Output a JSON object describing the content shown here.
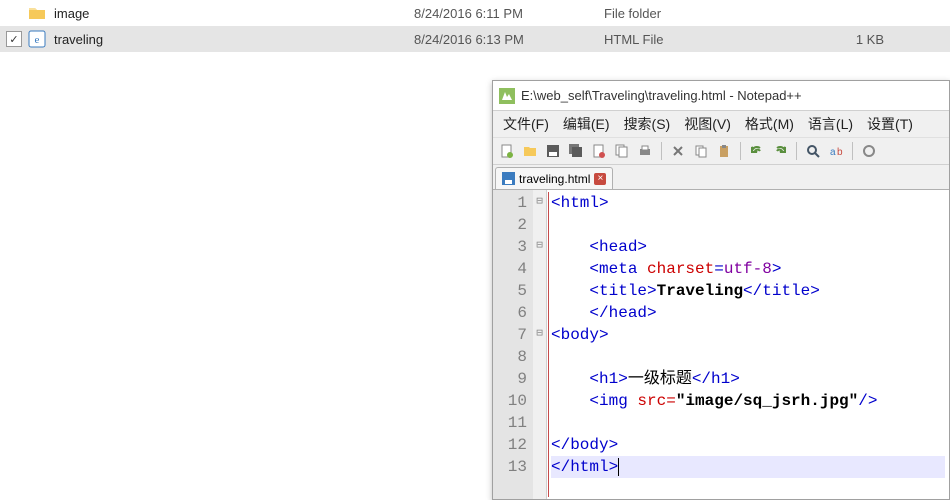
{
  "explorer": {
    "rows": [
      {
        "checked": false,
        "icon": "folder",
        "name": "image",
        "date": "8/24/2016 6:11 PM",
        "type": "File folder",
        "size": ""
      },
      {
        "checked": true,
        "icon": "html",
        "name": "traveling",
        "date": "8/24/2016 6:13 PM",
        "type": "HTML File",
        "size": "1 KB"
      }
    ]
  },
  "npp": {
    "title": "E:\\web_self\\Traveling\\traveling.html - Notepad++",
    "menu": [
      "文件(F)",
      "编辑(E)",
      "搜索(S)",
      "视图(V)",
      "格式(M)",
      "语言(L)",
      "设置(T)"
    ],
    "tab": "traveling.html",
    "lines_count": 13,
    "code": {
      "l1": {
        "indent": "",
        "parts": [
          {
            "t": "tag",
            "v": "<html>"
          }
        ]
      },
      "l2": {
        "indent": "",
        "parts": []
      },
      "l3": {
        "indent": "    ",
        "parts": [
          {
            "t": "tag",
            "v": "<head>"
          }
        ]
      },
      "l4": {
        "indent": "    ",
        "parts": [
          {
            "t": "tag",
            "v": "<meta "
          },
          {
            "t": "attr",
            "v": "charset"
          },
          {
            "t": "tag",
            "v": "="
          },
          {
            "t": "val",
            "v": "utf-8"
          },
          {
            "t": "tag",
            "v": ">"
          }
        ]
      },
      "l5": {
        "indent": "    ",
        "parts": [
          {
            "t": "tag",
            "v": "<title>"
          },
          {
            "t": "txt-bold",
            "v": "Traveling"
          },
          {
            "t": "tag",
            "v": "</title>"
          }
        ]
      },
      "l6": {
        "indent": "    ",
        "parts": [
          {
            "t": "tag",
            "v": "</head>"
          }
        ]
      },
      "l7": {
        "indent": "",
        "parts": [
          {
            "t": "tag",
            "v": "<body>"
          }
        ]
      },
      "l8": {
        "indent": "",
        "parts": []
      },
      "l9": {
        "indent": "    ",
        "parts": [
          {
            "t": "tag",
            "v": "<h1>"
          },
          {
            "t": "cjk",
            "v": "一级标题"
          },
          {
            "t": "tag",
            "v": "</h1>"
          }
        ]
      },
      "l10": {
        "indent": "    ",
        "parts": [
          {
            "t": "tag",
            "v": "<img "
          },
          {
            "t": "attr",
            "v": "src="
          },
          {
            "t": "txt-bold",
            "v": "\"image/sq_jsrh.jpg\""
          },
          {
            "t": "tag",
            "v": "/>"
          }
        ]
      },
      "l11": {
        "indent": "",
        "parts": []
      },
      "l12": {
        "indent": "",
        "parts": [
          {
            "t": "tag",
            "v": "</body>"
          }
        ]
      },
      "l13": {
        "indent": "",
        "parts": [
          {
            "t": "tag",
            "v": "</html>"
          }
        ],
        "current": true
      }
    },
    "fold": [
      "⊟",
      "",
      "⊟",
      "",
      "",
      "",
      "⊟",
      "",
      "",
      "",
      "",
      "",
      ""
    ]
  }
}
